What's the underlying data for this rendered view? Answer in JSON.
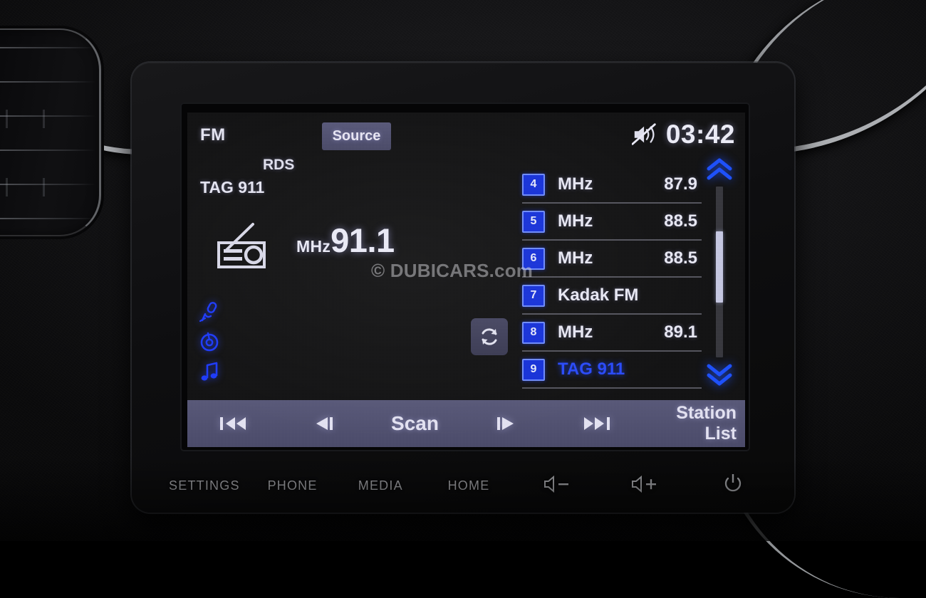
{
  "display": {
    "band": "FM",
    "source_button_label": "Source",
    "rds_label": "RDS",
    "station_name": "TAG 911",
    "frequency_unit": "MHz",
    "frequency_value": "91.1",
    "clock": "03:42",
    "mute_icon": "speaker-muted-icon",
    "radio_icon": "radio-icon",
    "refresh_icon": "refresh-icon",
    "watermark": "© DUBICARS.com",
    "source_icons": [
      {
        "name": "microphone-icon"
      },
      {
        "name": "disc-icon"
      },
      {
        "name": "music-note-icon"
      }
    ]
  },
  "preset_list": {
    "rows": [
      {
        "number": "4",
        "label": "MHz",
        "value": "87.9",
        "active": false
      },
      {
        "number": "5",
        "label": "MHz",
        "value": "88.5",
        "active": false
      },
      {
        "number": "6",
        "label": "MHz",
        "value": "88.5",
        "active": false
      },
      {
        "number": "7",
        "label": "Kadak FM",
        "value": "",
        "active": false
      },
      {
        "number": "8",
        "label": "MHz",
        "value": "89.1",
        "active": false
      },
      {
        "number": "9",
        "label": "TAG 911",
        "value": "",
        "active": true
      }
    ],
    "scroll_up_icon": "chevron-up-icon",
    "scroll_down_icon": "chevron-down-icon",
    "scroll_position_percent": 45
  },
  "toolbar": {
    "prev_station_icon": "skip-previous-icon",
    "tune_down_icon": "step-backward-icon",
    "scan_label": "Scan",
    "tune_up_icon": "step-forward-icon",
    "next_station_icon": "skip-next-icon",
    "station_list_line1": "Station",
    "station_list_line2": "List"
  },
  "hardware_buttons": [
    {
      "label": "SETTINGS",
      "icon": ""
    },
    {
      "label": "PHONE",
      "icon": ""
    },
    {
      "label": "MEDIA",
      "icon": ""
    },
    {
      "label": "HOME",
      "icon": ""
    },
    {
      "label": "",
      "icon": "volume-down-icon"
    },
    {
      "label": "",
      "icon": "volume-up-icon"
    },
    {
      "label": "",
      "icon": "power-icon"
    }
  ],
  "colors": {
    "accent_blue": "#2a4cff",
    "preset_badge": "#1733dd",
    "panel_purple": "#4c4c6b",
    "screen_text": "#ececf8"
  }
}
